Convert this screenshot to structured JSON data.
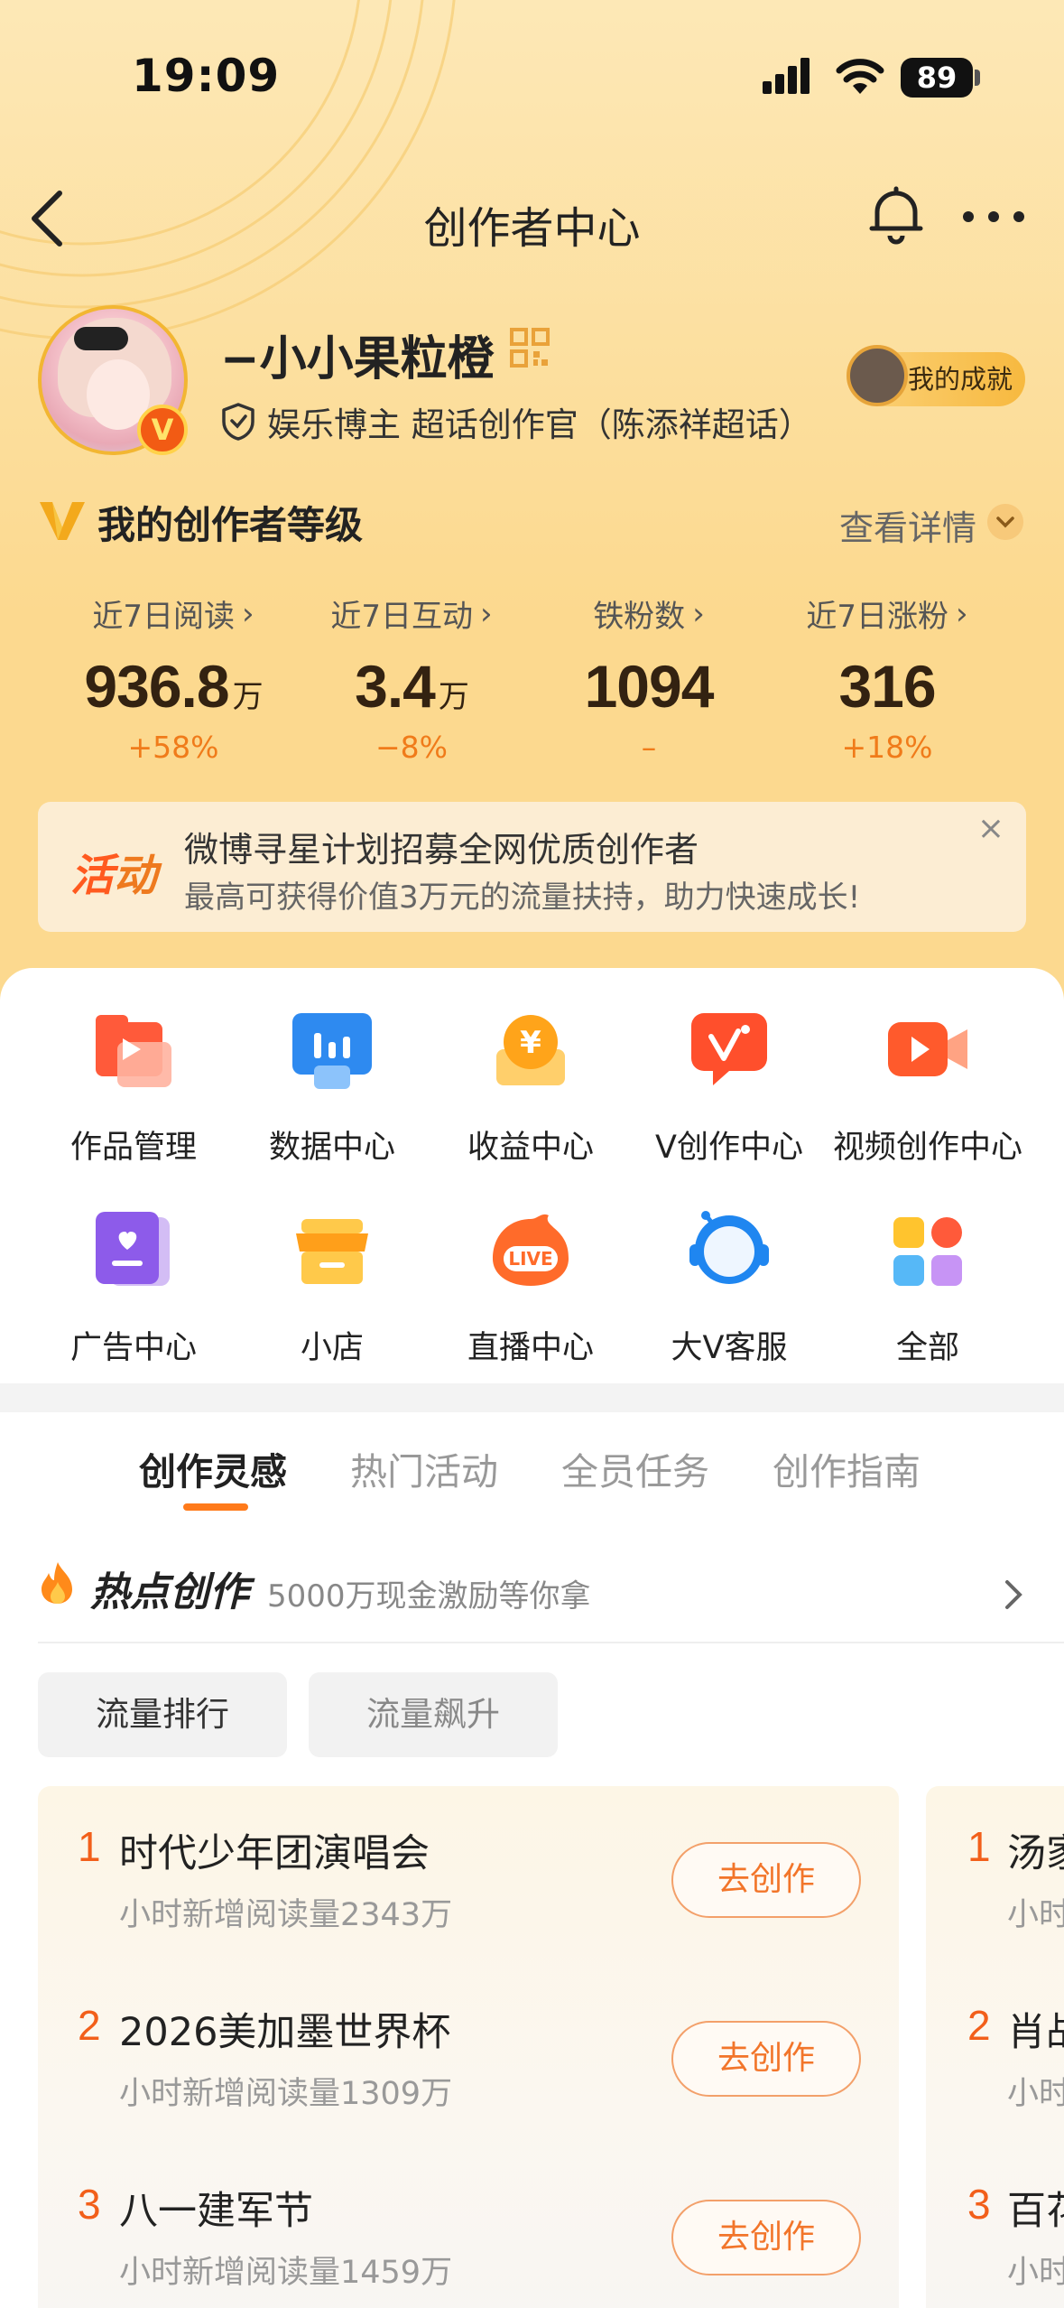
{
  "status": {
    "time": "19:09",
    "battery": "89"
  },
  "nav": {
    "title": "创作者中心"
  },
  "profile": {
    "name": "−小小果粒橙",
    "verify": "娱乐博主 超话创作官（陈添祥超话）",
    "achievement": "我的成就",
    "vbadge": "V"
  },
  "level": {
    "title": "我的创作者等级",
    "detail": "查看详情"
  },
  "stats": [
    {
      "label": "近7日阅读",
      "value": "936.8",
      "unit": "万",
      "change": "+58%"
    },
    {
      "label": "近7日互动",
      "value": "3.4",
      "unit": "万",
      "change": "−8%"
    },
    {
      "label": "铁粉数",
      "value": "1094",
      "unit": "",
      "change": "–"
    },
    {
      "label": "近7日涨粉",
      "value": "316",
      "unit": "",
      "change": "+18%"
    }
  ],
  "banner": {
    "tag_a": "活",
    "tag_b": "动",
    "line1": "微博寻星计划招募全网优质创作者",
    "line2": "最高可获得价值3万元的流量扶持，助力快速成长!"
  },
  "grid": [
    {
      "label": "作品管理",
      "icon": "works-icon"
    },
    {
      "label": "数据中心",
      "icon": "data-icon"
    },
    {
      "label": "收益中心",
      "icon": "income-icon"
    },
    {
      "label": "V创作中心",
      "icon": "v-create-icon"
    },
    {
      "label": "视频创作中心",
      "icon": "video-icon"
    },
    {
      "label": "广告中心",
      "icon": "ad-icon"
    },
    {
      "label": "小店",
      "icon": "shop-icon"
    },
    {
      "label": "直播中心",
      "icon": "live-icon"
    },
    {
      "label": "大V客服",
      "icon": "service-icon"
    },
    {
      "label": "全部",
      "icon": "all-icon"
    }
  ],
  "tabs": [
    "创作灵感",
    "热门活动",
    "全员任务",
    "创作指南"
  ],
  "hot": {
    "title": "热点创作",
    "subtitle": "5000万现金激励等你拿"
  },
  "pills": [
    "流量排行",
    "流量飙升"
  ],
  "ranking": [
    {
      "rank": "1",
      "title": "时代少年团演唱会",
      "sub": "小时新增阅读量2343万",
      "button": "去创作"
    },
    {
      "rank": "2",
      "title": "2026美加墨世界杯",
      "sub": "小时新增阅读量1309万",
      "button": "去创作"
    },
    {
      "rank": "3",
      "title": "八一建军节",
      "sub": "小时新增阅读量1459万",
      "button": "去创作"
    }
  ],
  "ranking2": [
    {
      "rank": "1",
      "title": "汤家",
      "sub": "小时"
    },
    {
      "rank": "2",
      "title": "肖战",
      "sub": "小时"
    },
    {
      "rank": "3",
      "title": "百花",
      "sub": "小时"
    }
  ]
}
